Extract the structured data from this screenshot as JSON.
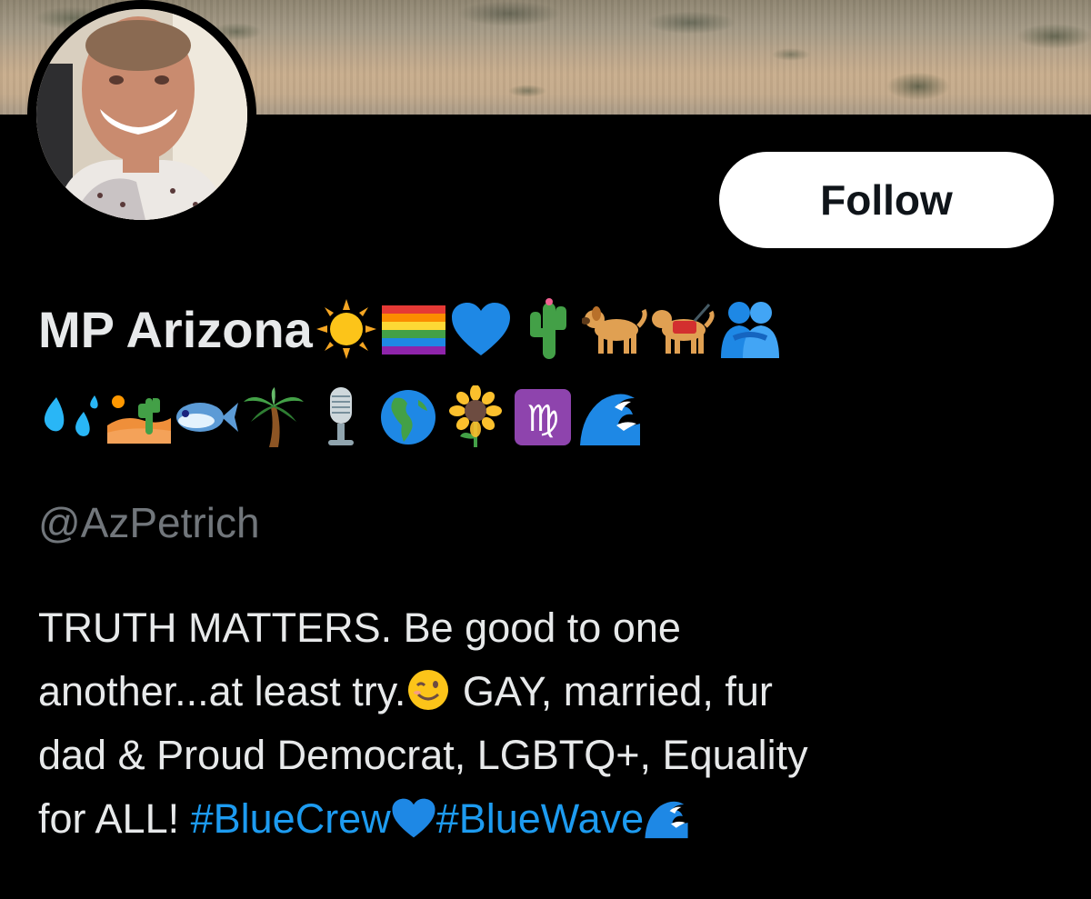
{
  "profile": {
    "display_name": "MP Arizona",
    "name_emojis_line1": [
      "sun",
      "rainbow-flag",
      "blue-heart",
      "cactus",
      "dog",
      "service-dog",
      "people-hugging"
    ],
    "name_emojis_line2": [
      "droplets",
      "desert",
      "fish",
      "palm-tree",
      "microphone",
      "globe-americas",
      "sunflower",
      "virgo",
      "wave"
    ],
    "handle": "@AzPetrich",
    "follow_label": "Follow",
    "bio": {
      "line1": "TRUTH MATTERS. Be good to one",
      "line2_a": "another...at least try.",
      "line2_b": " GAY, married, fur",
      "line3": "dad & Proud Democrat, LGBTQ+, Equality",
      "line4_a": "for ALL! ",
      "hashtag1": "#BlueCrew",
      "hashtag2": "#BlueWave"
    }
  },
  "colors": {
    "background": "#000000",
    "text": "#e7e9ea",
    "secondary_text": "#71767b",
    "link": "#1d9bf0",
    "button_bg": "#ffffff",
    "button_text": "#0f1419"
  }
}
